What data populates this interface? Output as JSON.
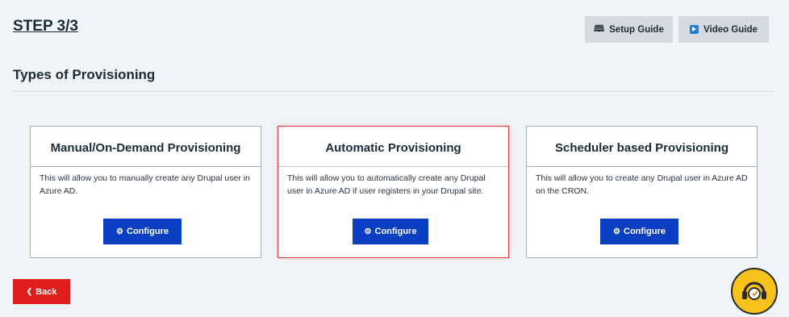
{
  "header": {
    "step_title": "STEP 3/3",
    "setup_guide_label": "Setup Guide",
    "video_guide_label": "Video Guide"
  },
  "section": {
    "title": "Types of Provisioning"
  },
  "cards": [
    {
      "title": "Manual/On-Demand Provisioning",
      "description": "This will allow you to manually create any Drupal user in Azure AD.",
      "button_label": "Configure",
      "highlighted": false
    },
    {
      "title": "Automatic Provisioning",
      "description": "This will allow you to automatically create any Drupal user in Azure AD if user registers in your Drupal site.",
      "button_label": "Configure",
      "highlighted": true
    },
    {
      "title": "Scheduler based Provisioning",
      "description": "This will allow you to create any Drupal user in Azure AD on the CRON.",
      "button_label": "Configure",
      "highlighted": false
    }
  ],
  "footer": {
    "back_label": "Back"
  },
  "icons": {
    "setup_guide": "book-icon",
    "video_guide": "video-icon",
    "configure": "gear-icon",
    "back": "chevron-left-icon",
    "support": "headset-support-icon"
  },
  "colors": {
    "page_background": "#f1f4f7",
    "configure_button": "#0a3fc2",
    "back_button": "#e11d1d",
    "highlight_border": "#d23a3a",
    "guide_button": "#d4dadf",
    "support_widget": "#f6c21b"
  }
}
